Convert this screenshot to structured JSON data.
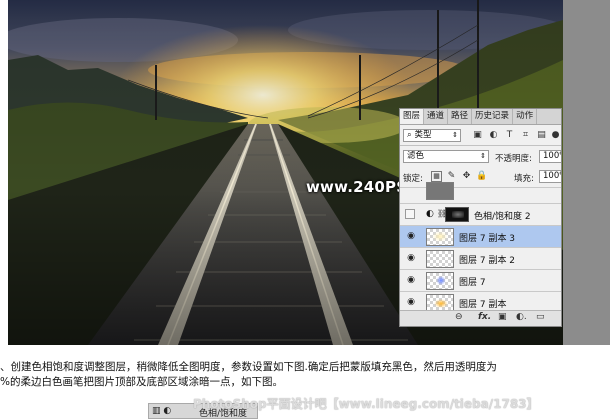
{
  "watermark": "www.240PS.com",
  "layers_panel": {
    "tabs": [
      "图层",
      "通道",
      "路径",
      "历史记录",
      "动作"
    ],
    "filter_type": "类型",
    "blend_mode": "滤色",
    "opacity_label": "不透明度:",
    "opacity_value": "100%",
    "lock_label": "锁定:",
    "fill_label": "填充:",
    "fill_value": "100%",
    "layers": [
      {
        "name": "色相/饱和度 2",
        "selected": false
      },
      {
        "name": "图层 7 副本 3",
        "selected": true
      },
      {
        "name": "图层 7 副本 2",
        "selected": false
      },
      {
        "name": "图层 7",
        "selected": false
      },
      {
        "name": "图层 7 副本",
        "selected": false
      }
    ],
    "footer_icons": [
      "link-icon",
      "fx-icon",
      "mask-icon",
      "adjustment-icon",
      "folder-icon"
    ],
    "footer_fx": "fx."
  },
  "caption": {
    "line1": "、创建色相饱和度调整图层，稍微降低全图明度，参数设置如下图.确定后把蒙版填充黑色，然后用透明度为",
    "line2": "%的柔边白色画笔把图片顶部及底部区域涂暗一点，如下图。"
  },
  "snippet": {
    "title": "色相/饱和度"
  },
  "forum_watermark": "PhotoShop平面设计吧【www.lineeg.com/tieba/1783】"
}
